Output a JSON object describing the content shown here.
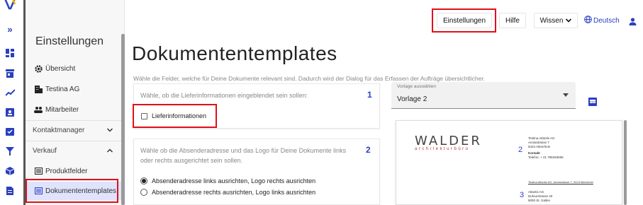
{
  "rail": {
    "icons": [
      "logo-icon",
      "expand-icon",
      "dashboard-icon",
      "store-icon",
      "trend-icon",
      "contacts-icon",
      "task-icon",
      "filter-icon",
      "box-icon",
      "document-icon"
    ]
  },
  "sidebar": {
    "title": "Einstellungen",
    "items": [
      {
        "label": "Übersicht",
        "icon": "gear-icon"
      },
      {
        "label": "Testina AG",
        "icon": "building-icon"
      },
      {
        "label": "Mitarbeiter",
        "icon": "people-icon"
      }
    ],
    "sections": [
      {
        "label": "Kontaktmanager",
        "expanded": false
      },
      {
        "label": "Verkauf",
        "expanded": true
      }
    ],
    "sub_items": [
      {
        "label": "Produktfelder",
        "icon": "list-icon"
      },
      {
        "label": "Dokumententemplates",
        "icon": "list-icon",
        "active": true
      }
    ]
  },
  "topbar": {
    "settings_label": "Einstellungen",
    "help_label": "Hilfe",
    "knowledge_label": "Wissen",
    "language_label": "Deutsch",
    "user_icon": "user-icon"
  },
  "main": {
    "title": "Dokumententemplates",
    "subtitle": "Wähle die Felder, welche für Deine Dokumente relevant sind. Dadurch wird der Dialog für das Erfassen der Aufträge übersichtlicher.",
    "card1": {
      "hint": "Wähle, ob die Lieferinformationen eingeblendet sein sollen:",
      "number": "1",
      "checkbox_label": "Lieferinformationen",
      "checked": false
    },
    "card2": {
      "hint": "Wähle ob die Absenderadresse und das Logo für Deine Dokumente links oder rechts ausgerichtet sein sollen.",
      "number": "2",
      "option1": "Absenderadresse links ausrichten, Logo rechts ausrichten",
      "option2": "Absenderadresse rechts ausrichten, Logo links ausrichten",
      "selected": 1
    },
    "template_select": {
      "label": "Vorlage auswählen",
      "value": "Vorlage 2"
    },
    "preview_icon": "pdf-icon"
  },
  "preview": {
    "logo_main": "WALDER",
    "logo_sub": "architekturbüro",
    "num2": "2",
    "num3": "3",
    "sender_lines": [
      "Testina Atlantis AG",
      "Anniastrasse 7",
      "9423 Altenrhein"
    ],
    "contact_label": "Kontakt",
    "contact_line": "Telefon:       + 41 795345555",
    "return_line": "Testina Atlantis AG, Anniastrasse 7, 9423 Altenrhein",
    "recipient_lines": [
      "Atlantis AG",
      "Dufourstrasse 40",
      "9000 St. Gallen"
    ]
  },
  "colors": {
    "accent": "#2a3fbf",
    "highlight": "#e0101a",
    "active_bg": "#dfe3fb"
  }
}
